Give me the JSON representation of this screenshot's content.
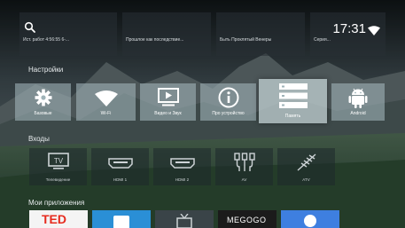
{
  "topbar": {
    "time": "17:31",
    "icons": [
      "search-icon",
      "wifi-icon"
    ]
  },
  "recommendations": [
    {
      "label": "Ист. работ 4:56:55 6-..."
    },
    {
      "label": "Прошлое как последствие..."
    },
    {
      "label": "Быть Проклятый Венеры"
    },
    {
      "label": "Серия..."
    }
  ],
  "settings": {
    "title": "Настройки",
    "items": [
      {
        "label": "Базовые",
        "icon": "gear-icon"
      },
      {
        "label": "Wi-Fi",
        "icon": "wifi-icon"
      },
      {
        "label": "Видео и Звук",
        "icon": "display-icon"
      },
      {
        "label": "Про устройство",
        "icon": "info-icon"
      },
      {
        "label": "Память",
        "icon": "storage-icon",
        "focused": true
      },
      {
        "label": "Android",
        "icon": "android-icon"
      }
    ]
  },
  "inputs": {
    "title": "Входы",
    "items": [
      {
        "label": "Телевидение",
        "icon": "tv-icon"
      },
      {
        "label": "HDMI 1",
        "icon": "hdmi-icon"
      },
      {
        "label": "HDMI 2",
        "icon": "hdmi-icon"
      },
      {
        "label": "AV",
        "icon": "av-icon"
      },
      {
        "label": "ATV",
        "icon": "antenna-icon"
      }
    ]
  },
  "apps": {
    "title": "Мои приложения",
    "items": [
      {
        "name": "TED",
        "color": "#e62b1e"
      },
      {
        "name": "",
        "color": "#2a8fd6"
      },
      {
        "name": "",
        "color": "#3a4448"
      },
      {
        "name": "MEGOGO",
        "color": "#1b1b1b"
      },
      {
        "name": "",
        "color": "#3e7fe0"
      }
    ]
  },
  "colors": {
    "tile": "#aabec3",
    "focused_tile": "#c8d7da",
    "accent_ted": "#e62b1e"
  }
}
